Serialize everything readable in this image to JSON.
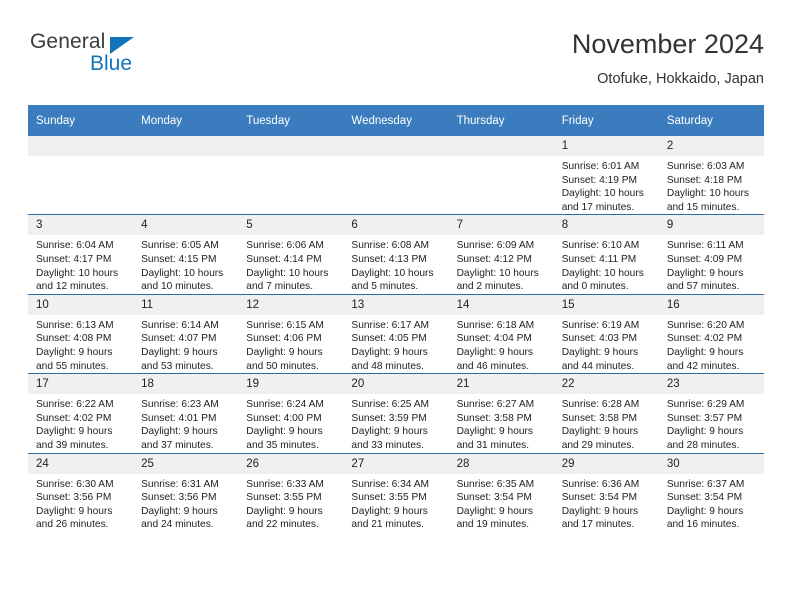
{
  "brand": {
    "word_top": "General",
    "word_bottom": "Blue",
    "triangle_color": "#1275bc",
    "text_color": "#3c3c3c"
  },
  "header": {
    "title": "November 2024",
    "subtitle": "Otofuke, Hokkaido, Japan"
  },
  "theme": {
    "header_blue": "#3a7cbd",
    "row_divider_blue": "#2e6da4",
    "daynum_strip": "#f0f0f0"
  },
  "weekday_headers": [
    "Sunday",
    "Monday",
    "Tuesday",
    "Wednesday",
    "Thursday",
    "Friday",
    "Saturday"
  ],
  "labels": {
    "sunrise_prefix": "Sunrise:",
    "sunset_prefix": "Sunset:",
    "daylight_prefix": "Daylight:"
  },
  "weeks": [
    [
      {
        "day": "",
        "sunrise": "",
        "sunset": "",
        "daylight_1": "",
        "daylight_2": ""
      },
      {
        "day": "",
        "sunrise": "",
        "sunset": "",
        "daylight_1": "",
        "daylight_2": ""
      },
      {
        "day": "",
        "sunrise": "",
        "sunset": "",
        "daylight_1": "",
        "daylight_2": ""
      },
      {
        "day": "",
        "sunrise": "",
        "sunset": "",
        "daylight_1": "",
        "daylight_2": ""
      },
      {
        "day": "",
        "sunrise": "",
        "sunset": "",
        "daylight_1": "",
        "daylight_2": ""
      },
      {
        "day": "1",
        "sunrise": "Sunrise: 6:01 AM",
        "sunset": "Sunset: 4:19 PM",
        "daylight_1": "Daylight: 10 hours",
        "daylight_2": "and 17 minutes."
      },
      {
        "day": "2",
        "sunrise": "Sunrise: 6:03 AM",
        "sunset": "Sunset: 4:18 PM",
        "daylight_1": "Daylight: 10 hours",
        "daylight_2": "and 15 minutes."
      }
    ],
    [
      {
        "day": "3",
        "sunrise": "Sunrise: 6:04 AM",
        "sunset": "Sunset: 4:17 PM",
        "daylight_1": "Daylight: 10 hours",
        "daylight_2": "and 12 minutes."
      },
      {
        "day": "4",
        "sunrise": "Sunrise: 6:05 AM",
        "sunset": "Sunset: 4:15 PM",
        "daylight_1": "Daylight: 10 hours",
        "daylight_2": "and 10 minutes."
      },
      {
        "day": "5",
        "sunrise": "Sunrise: 6:06 AM",
        "sunset": "Sunset: 4:14 PM",
        "daylight_1": "Daylight: 10 hours",
        "daylight_2": "and 7 minutes."
      },
      {
        "day": "6",
        "sunrise": "Sunrise: 6:08 AM",
        "sunset": "Sunset: 4:13 PM",
        "daylight_1": "Daylight: 10 hours",
        "daylight_2": "and 5 minutes."
      },
      {
        "day": "7",
        "sunrise": "Sunrise: 6:09 AM",
        "sunset": "Sunset: 4:12 PM",
        "daylight_1": "Daylight: 10 hours",
        "daylight_2": "and 2 minutes."
      },
      {
        "day": "8",
        "sunrise": "Sunrise: 6:10 AM",
        "sunset": "Sunset: 4:11 PM",
        "daylight_1": "Daylight: 10 hours",
        "daylight_2": "and 0 minutes."
      },
      {
        "day": "9",
        "sunrise": "Sunrise: 6:11 AM",
        "sunset": "Sunset: 4:09 PM",
        "daylight_1": "Daylight: 9 hours",
        "daylight_2": "and 57 minutes."
      }
    ],
    [
      {
        "day": "10",
        "sunrise": "Sunrise: 6:13 AM",
        "sunset": "Sunset: 4:08 PM",
        "daylight_1": "Daylight: 9 hours",
        "daylight_2": "and 55 minutes."
      },
      {
        "day": "11",
        "sunrise": "Sunrise: 6:14 AM",
        "sunset": "Sunset: 4:07 PM",
        "daylight_1": "Daylight: 9 hours",
        "daylight_2": "and 53 minutes."
      },
      {
        "day": "12",
        "sunrise": "Sunrise: 6:15 AM",
        "sunset": "Sunset: 4:06 PM",
        "daylight_1": "Daylight: 9 hours",
        "daylight_2": "and 50 minutes."
      },
      {
        "day": "13",
        "sunrise": "Sunrise: 6:17 AM",
        "sunset": "Sunset: 4:05 PM",
        "daylight_1": "Daylight: 9 hours",
        "daylight_2": "and 48 minutes."
      },
      {
        "day": "14",
        "sunrise": "Sunrise: 6:18 AM",
        "sunset": "Sunset: 4:04 PM",
        "daylight_1": "Daylight: 9 hours",
        "daylight_2": "and 46 minutes."
      },
      {
        "day": "15",
        "sunrise": "Sunrise: 6:19 AM",
        "sunset": "Sunset: 4:03 PM",
        "daylight_1": "Daylight: 9 hours",
        "daylight_2": "and 44 minutes."
      },
      {
        "day": "16",
        "sunrise": "Sunrise: 6:20 AM",
        "sunset": "Sunset: 4:02 PM",
        "daylight_1": "Daylight: 9 hours",
        "daylight_2": "and 42 minutes."
      }
    ],
    [
      {
        "day": "17",
        "sunrise": "Sunrise: 6:22 AM",
        "sunset": "Sunset: 4:02 PM",
        "daylight_1": "Daylight: 9 hours",
        "daylight_2": "and 39 minutes."
      },
      {
        "day": "18",
        "sunrise": "Sunrise: 6:23 AM",
        "sunset": "Sunset: 4:01 PM",
        "daylight_1": "Daylight: 9 hours",
        "daylight_2": "and 37 minutes."
      },
      {
        "day": "19",
        "sunrise": "Sunrise: 6:24 AM",
        "sunset": "Sunset: 4:00 PM",
        "daylight_1": "Daylight: 9 hours",
        "daylight_2": "and 35 minutes."
      },
      {
        "day": "20",
        "sunrise": "Sunrise: 6:25 AM",
        "sunset": "Sunset: 3:59 PM",
        "daylight_1": "Daylight: 9 hours",
        "daylight_2": "and 33 minutes."
      },
      {
        "day": "21",
        "sunrise": "Sunrise: 6:27 AM",
        "sunset": "Sunset: 3:58 PM",
        "daylight_1": "Daylight: 9 hours",
        "daylight_2": "and 31 minutes."
      },
      {
        "day": "22",
        "sunrise": "Sunrise: 6:28 AM",
        "sunset": "Sunset: 3:58 PM",
        "daylight_1": "Daylight: 9 hours",
        "daylight_2": "and 29 minutes."
      },
      {
        "day": "23",
        "sunrise": "Sunrise: 6:29 AM",
        "sunset": "Sunset: 3:57 PM",
        "daylight_1": "Daylight: 9 hours",
        "daylight_2": "and 28 minutes."
      }
    ],
    [
      {
        "day": "24",
        "sunrise": "Sunrise: 6:30 AM",
        "sunset": "Sunset: 3:56 PM",
        "daylight_1": "Daylight: 9 hours",
        "daylight_2": "and 26 minutes."
      },
      {
        "day": "25",
        "sunrise": "Sunrise: 6:31 AM",
        "sunset": "Sunset: 3:56 PM",
        "daylight_1": "Daylight: 9 hours",
        "daylight_2": "and 24 minutes."
      },
      {
        "day": "26",
        "sunrise": "Sunrise: 6:33 AM",
        "sunset": "Sunset: 3:55 PM",
        "daylight_1": "Daylight: 9 hours",
        "daylight_2": "and 22 minutes."
      },
      {
        "day": "27",
        "sunrise": "Sunrise: 6:34 AM",
        "sunset": "Sunset: 3:55 PM",
        "daylight_1": "Daylight: 9 hours",
        "daylight_2": "and 21 minutes."
      },
      {
        "day": "28",
        "sunrise": "Sunrise: 6:35 AM",
        "sunset": "Sunset: 3:54 PM",
        "daylight_1": "Daylight: 9 hours",
        "daylight_2": "and 19 minutes."
      },
      {
        "day": "29",
        "sunrise": "Sunrise: 6:36 AM",
        "sunset": "Sunset: 3:54 PM",
        "daylight_1": "Daylight: 9 hours",
        "daylight_2": "and 17 minutes."
      },
      {
        "day": "30",
        "sunrise": "Sunrise: 6:37 AM",
        "sunset": "Sunset: 3:54 PM",
        "daylight_1": "Daylight: 9 hours",
        "daylight_2": "and 16 minutes."
      }
    ]
  ]
}
